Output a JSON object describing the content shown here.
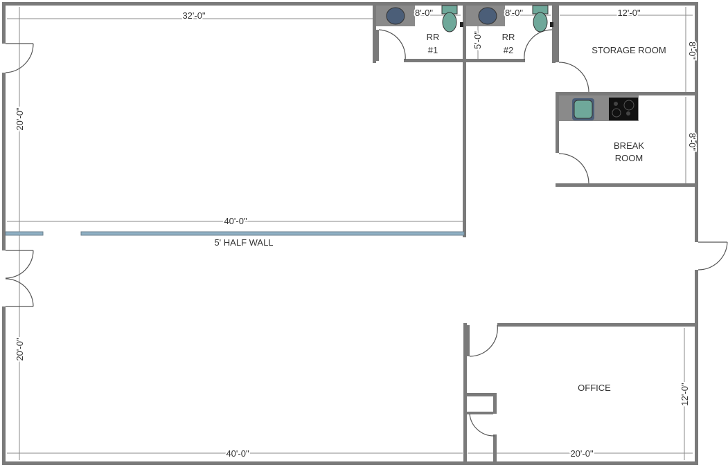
{
  "colors": {
    "wall": "#7a7a7a",
    "half_wall": "#8fb0c4",
    "fixture": "#6fa89a",
    "sink_blue": "#4b5e78"
  },
  "rooms": {
    "rr1": [
      "RR",
      "#1"
    ],
    "rr2": [
      "RR",
      "#2"
    ],
    "storage": "STORAGE ROOM",
    "break": [
      "BREAK",
      "ROOM"
    ],
    "office": "OFFICE",
    "half_wall": "5' HALF WALL"
  },
  "dimensions": {
    "top_main": "32'-0\"",
    "rr1_width": "8'-0\"",
    "rr2_width": "8'-0\"",
    "storage_width": "12'-0\"",
    "rr_depth": "5'-0\"",
    "storage_depth": "8'-0\"",
    "break_depth": "8'-0\"",
    "upper_left_height": "20'-0\"",
    "half_wall_length": "40'-0\"",
    "lower_left_height": "20'-0\"",
    "office_depth": "12'-0\"",
    "bottom_left": "40'-0\"",
    "bottom_right": "20'-0\""
  },
  "icons": [
    "sink-icon",
    "toilet-icon",
    "kitchen-sink-icon",
    "cooktop-icon",
    "door-swing-icon"
  ]
}
